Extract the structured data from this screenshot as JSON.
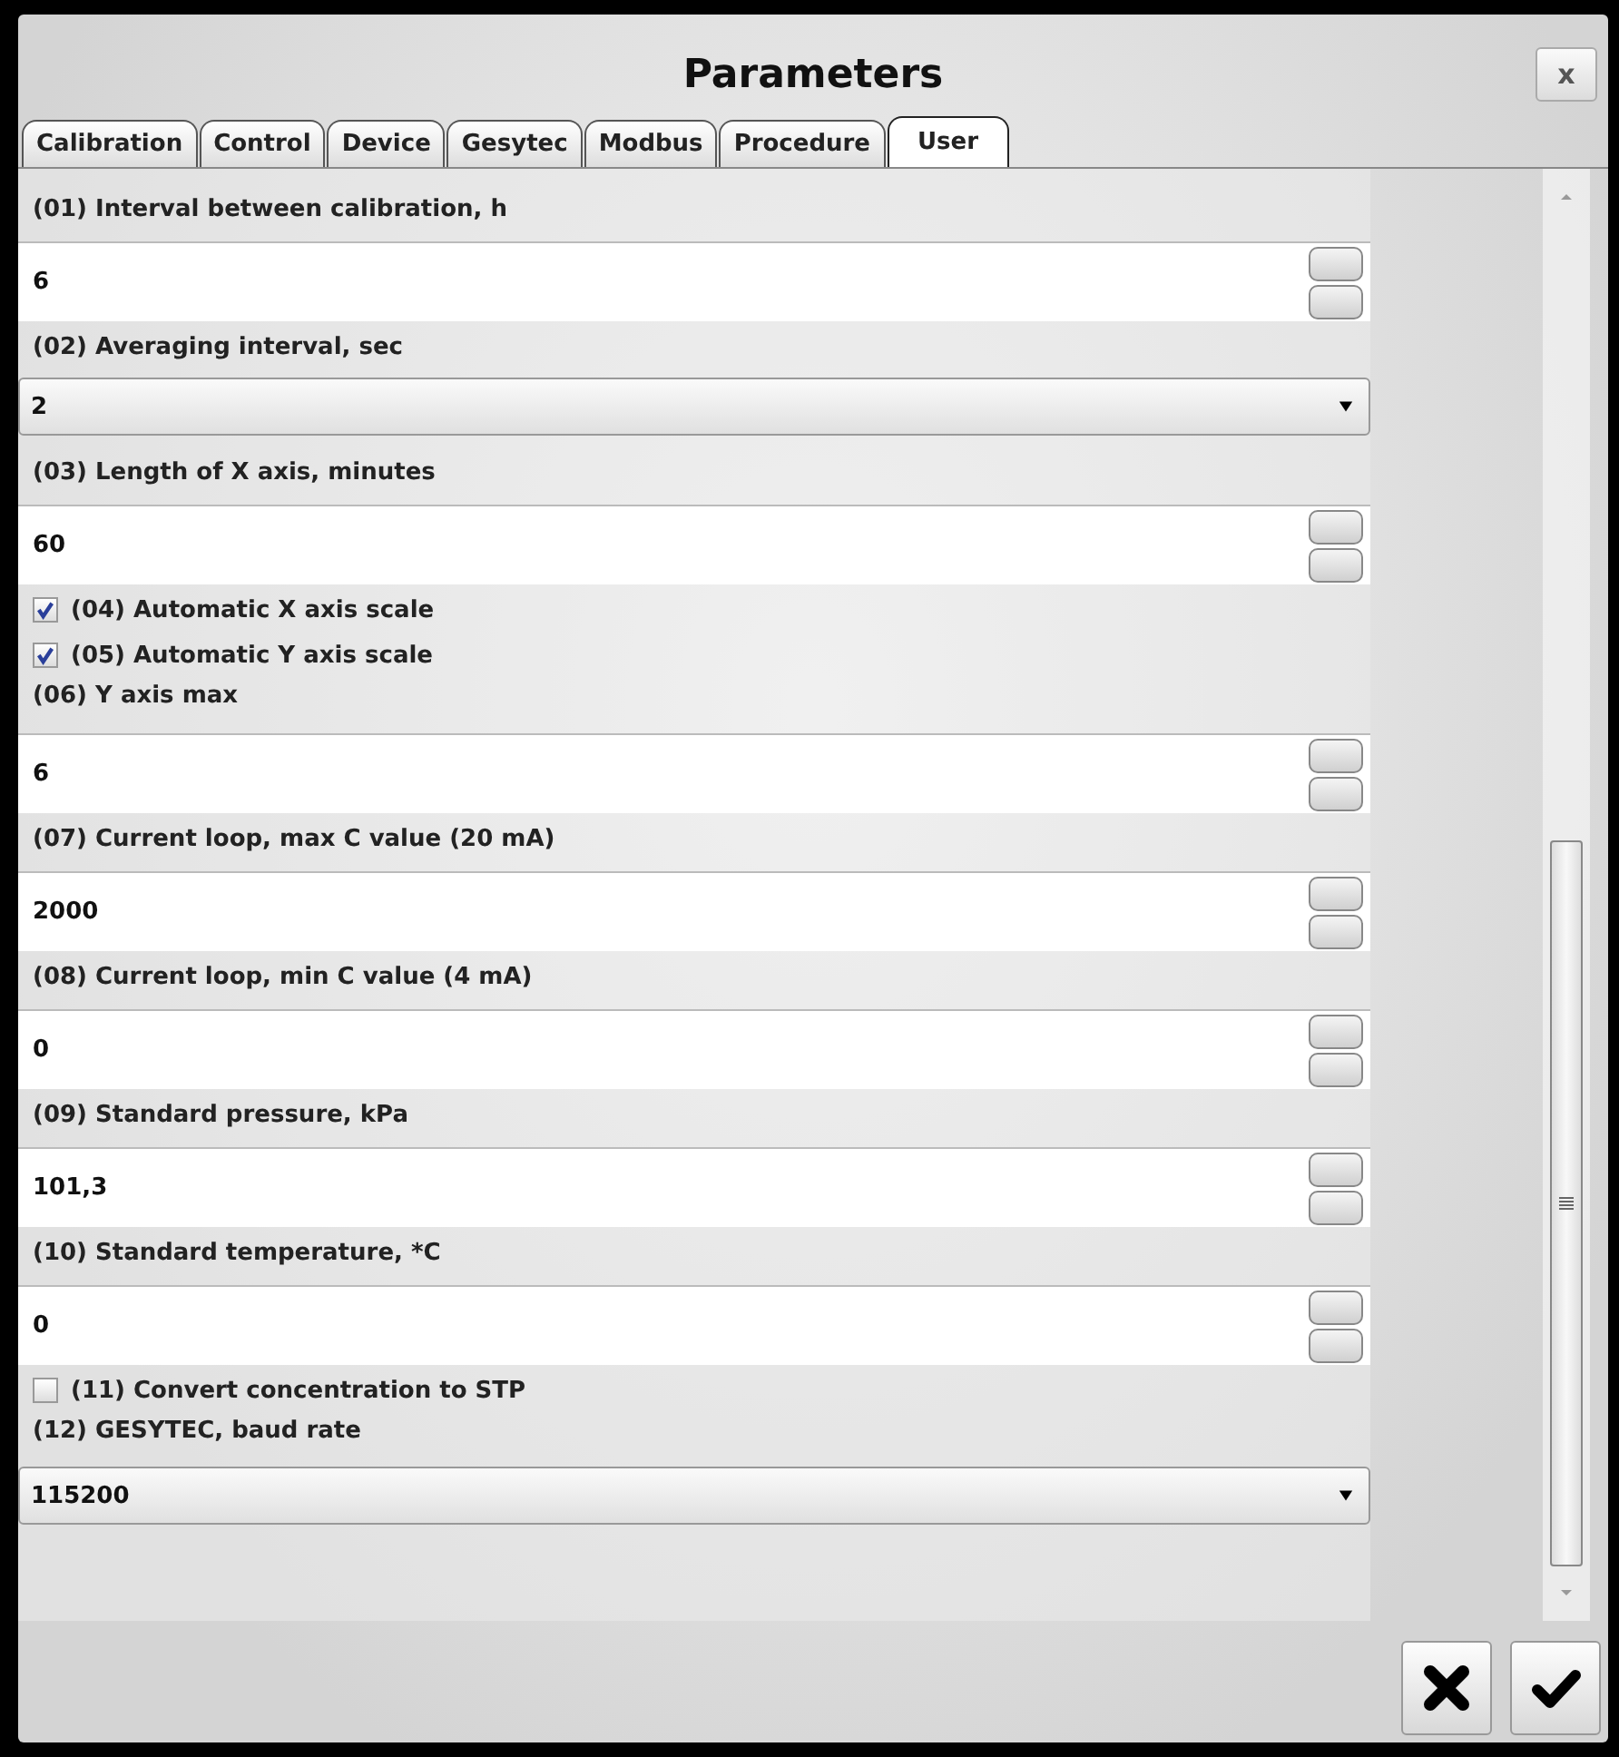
{
  "window": {
    "title": "Parameters",
    "close": "x"
  },
  "tabs": [
    {
      "label": "Calibration",
      "selected": false
    },
    {
      "label": "Control",
      "selected": false
    },
    {
      "label": "Device",
      "selected": false
    },
    {
      "label": "Gesytec",
      "selected": false
    },
    {
      "label": "Modbus",
      "selected": false
    },
    {
      "label": "Procedure",
      "selected": false
    },
    {
      "label": "User",
      "selected": true
    }
  ],
  "parameters": [
    {
      "kind": "spin",
      "label": "(01) Interval between calibration, h",
      "value": "6"
    },
    {
      "kind": "combo",
      "label": "(02) Averaging interval, sec",
      "value": "2"
    },
    {
      "kind": "spin",
      "label": "(03) Length of X axis, minutes",
      "value": "60"
    },
    {
      "kind": "check",
      "label": "(04) Automatic X axis scale",
      "checked": true
    },
    {
      "kind": "check",
      "label": "(05) Automatic Y axis scale",
      "checked": true
    },
    {
      "kind": "spin",
      "label": "(06) Y axis max",
      "value": "6"
    },
    {
      "kind": "spin",
      "label": "(07) Current loop, max C value (20 mA)",
      "value": "2000"
    },
    {
      "kind": "spin",
      "label": "(08) Current loop, min C value (4 mA)",
      "value": "0"
    },
    {
      "kind": "spin",
      "label": "(09) Standard pressure, kPa",
      "value": "101,3"
    },
    {
      "kind": "spin",
      "label": "(10) Standard temperature, *C",
      "value": "0"
    },
    {
      "kind": "check",
      "label": "(11) Convert concentration to STP",
      "checked": false
    },
    {
      "kind": "combo",
      "label": "(12) GESYTEC, baud rate",
      "value": "115200"
    }
  ]
}
